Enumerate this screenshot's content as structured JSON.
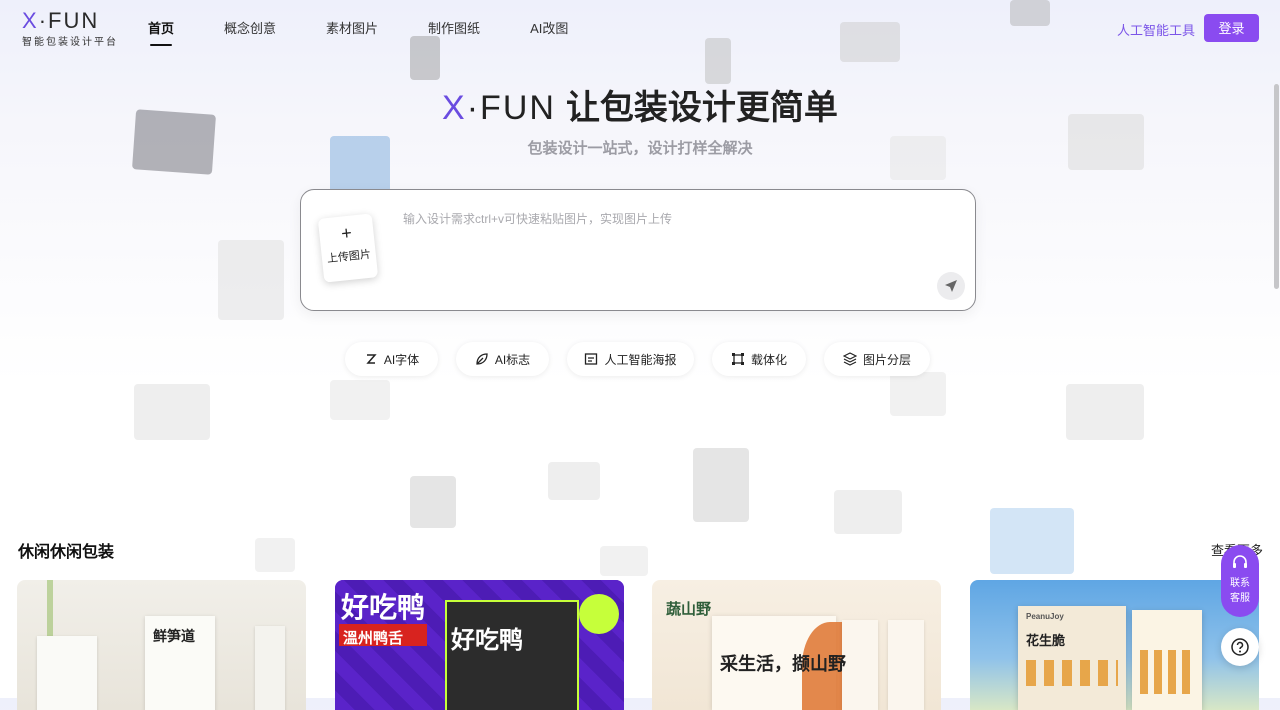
{
  "header": {
    "logo_word": "X·FUN",
    "logo_sub": "智能包装设计平台",
    "nav": [
      "首页",
      "概念创意",
      "素材图片",
      "制作图纸",
      "AI改图"
    ],
    "ai_tools": "人工智能工具",
    "login": "登录"
  },
  "hero": {
    "brand": "X·FUN",
    "title": "让包装设计更简单",
    "subtitle": "包装设计一站式，设计打样全解决"
  },
  "search": {
    "upload_label": "上传图片",
    "placeholder": "输入设计需求ctrl+v可快速粘贴图片，实现图片上传"
  },
  "chips": [
    "AI字体",
    "AI标志",
    "人工智能海报",
    "载体化",
    "图片分层"
  ],
  "section": {
    "title": "休闲休闲包装",
    "see_more": "查看更多"
  },
  "cards": [
    {
      "name": "鲜笋道",
      "text": "鲜笋道",
      "accent": "#7fa24a"
    },
    {
      "name": "好吃鸭",
      "text": "好吃鸭",
      "accent": "#6b2fd6",
      "sub": "溫州鸭舌"
    },
    {
      "name": "蔬山野",
      "text": "采生活，撷山野",
      "accent": "#e07b3a",
      "sub": "蔬山野"
    },
    {
      "name": "花生脆",
      "text": "花生脆",
      "accent": "#2f8fd6",
      "sub": "PeanuJoy"
    }
  ],
  "support": {
    "line1": "联系",
    "line2": "客服"
  },
  "colors": {
    "accent": "#8a4bf0",
    "brand_x": "#6a4ce0"
  }
}
